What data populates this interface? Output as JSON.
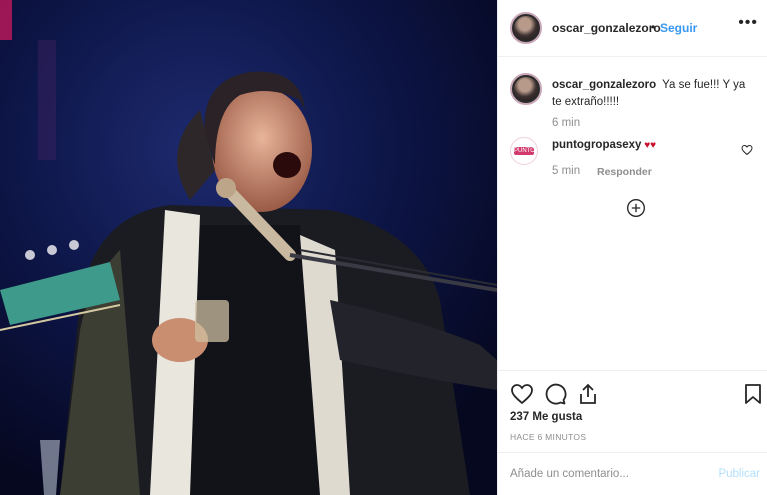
{
  "post": {
    "username": "oscar_gonzalezoro",
    "follow_label": "Seguir",
    "more_label": "•••",
    "separator": "•"
  },
  "caption": {
    "username": "oscar_gonzalezoro",
    "text": "Ya se fue!!! Y ya te extraño!!!!!",
    "time": "6 min"
  },
  "comment": {
    "username": "puntogropasexy",
    "text": " ♥♥",
    "time": "5 min",
    "reply_label": "Responder",
    "avatar_text": "PUNTO G"
  },
  "stats": {
    "likes": "237 Me gusta",
    "posted_ago": "HACE 6 MINUTOS"
  },
  "add_comment": {
    "placeholder": "Añade un comentario...",
    "publish_label": "Publicar"
  },
  "colors": {
    "link": "#3897f0",
    "publish_disabled": "#b2dffc",
    "heart": "#c8102e"
  },
  "icons": [
    "more-icon",
    "comment-heart-icon",
    "load-more-comments-icon",
    "like-icon",
    "comment-icon",
    "share-icon",
    "save-icon"
  ]
}
